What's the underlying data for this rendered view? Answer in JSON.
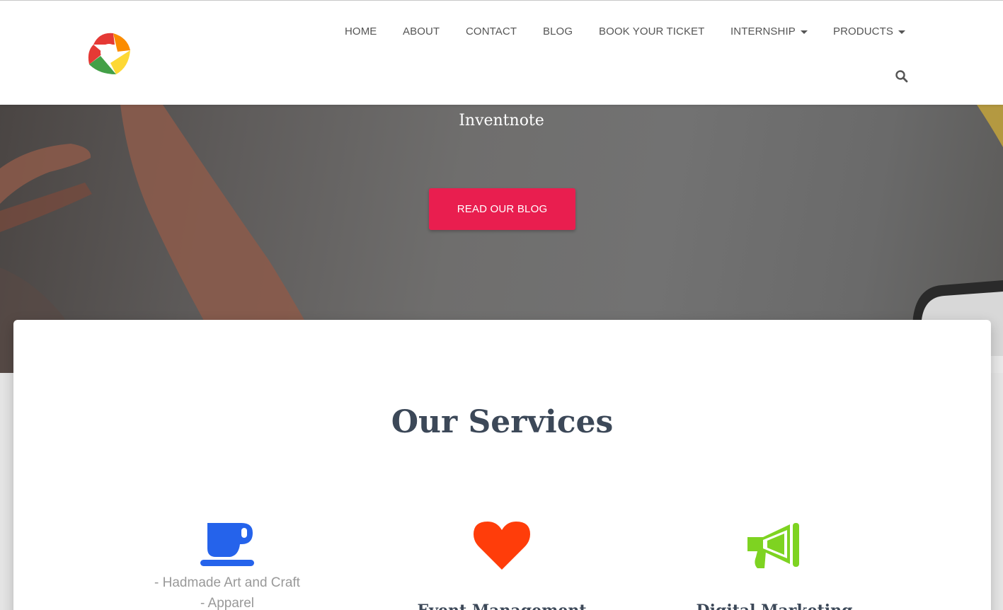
{
  "nav": {
    "items": [
      {
        "label": "HOME"
      },
      {
        "label": "ABOUT"
      },
      {
        "label": "CONTACT"
      },
      {
        "label": "BLOG"
      },
      {
        "label": "BOOK YOUR TICKET"
      },
      {
        "label": "INTERNSHIP"
      },
      {
        "label": "PRODUCTS"
      }
    ],
    "search_icon": "search-icon"
  },
  "hero": {
    "title": "Inventnote",
    "button_label": "READ OUR BLOG",
    "button_color": "#e91e4f"
  },
  "services": {
    "title": "Our Services",
    "items": [
      {
        "icon": "coffee-cup-icon",
        "color": "#2563eb",
        "lines": [
          "- Hadmade Art and Craft",
          "- Apparel"
        ],
        "name": ""
      },
      {
        "icon": "heart-icon",
        "color": "#ff3d0a",
        "lines": [],
        "name": "Event Management"
      },
      {
        "icon": "megaphone-icon",
        "color": "#7ed321",
        "lines": [],
        "name": "Digital Marketing"
      }
    ]
  }
}
